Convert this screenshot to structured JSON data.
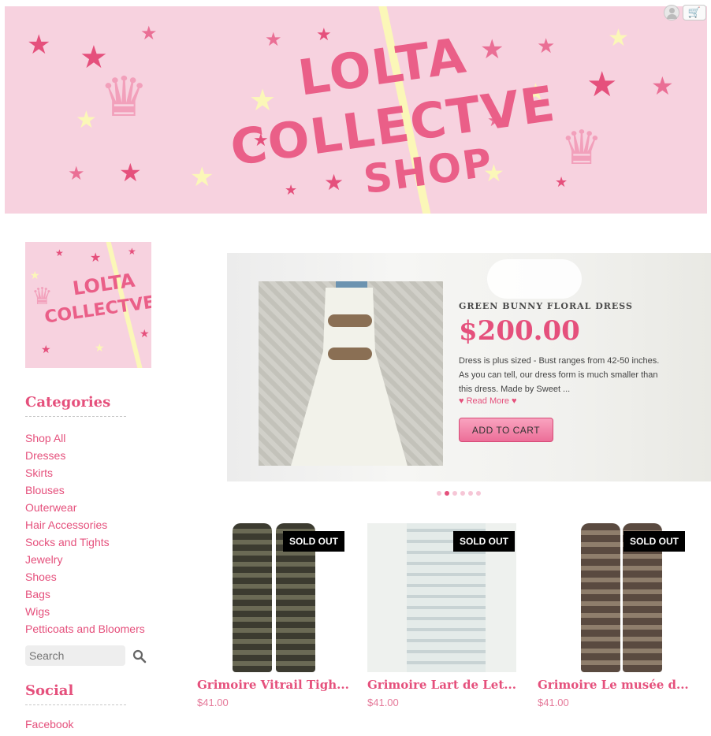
{
  "header": {
    "banner_line1": "LOLTA",
    "banner_line2": "COLLECTVE",
    "banner_line3": "SHOP",
    "account_icon": "user-icon",
    "cart_icon": "cart-icon"
  },
  "sidebar": {
    "logo_line1": "LOLTA",
    "logo_line2": "COLLECTVE",
    "categories_heading": "Categories",
    "categories": [
      "Shop All",
      "Dresses",
      "Skirts",
      "Blouses",
      "Outerwear",
      "Hair Accessories",
      "Socks and Tights",
      "Jewelry",
      "Shoes",
      "Bags",
      "Wigs",
      "Petticoats and Bloomers"
    ],
    "search_placeholder": "Search",
    "social_heading": "Social",
    "social_links": [
      "Facebook"
    ]
  },
  "featured": {
    "name": "GREEN BUNNY FLORAL DRESS",
    "price": "$200.00",
    "description": "Dress is plus sized - Bust ranges from 42-50 inches. As you can tell, our dress form is much smaller than this dress. Made by Sweet ...",
    "read_more": "♥ Read More ♥",
    "add_to_cart": "ADD TO CART",
    "slide_count": 6,
    "active_slide": 2
  },
  "products": [
    {
      "title": "Grimoire Vitrail Tigh...",
      "price": "$41.00",
      "badge": "SOLD OUT"
    },
    {
      "title": "Grimoire Lart de Let...",
      "price": "$41.00",
      "badge": "SOLD OUT"
    },
    {
      "title": "Grimoire Le musée d...",
      "price": "$41.00",
      "badge": "SOLD OUT"
    }
  ],
  "colors": {
    "brand_pink": "#e5507c",
    "banner_bg": "#f7d2df",
    "stripe_yellow": "#fbf7b8"
  }
}
